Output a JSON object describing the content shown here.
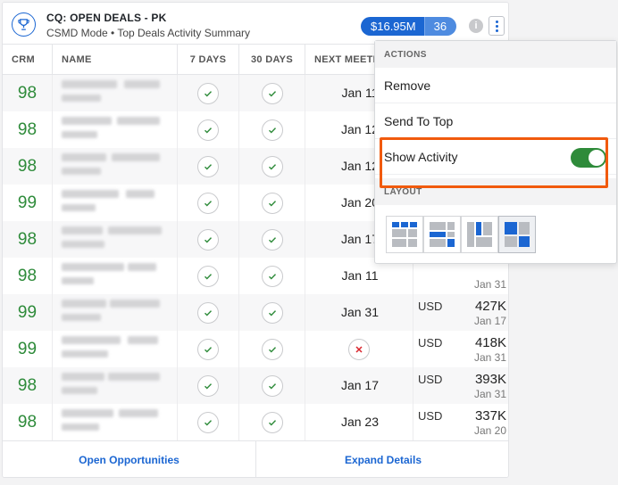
{
  "header": {
    "title": "CQ: OPEN DEALS - PK",
    "subtitle": "CSMD Mode • Top Deals Activity Summary",
    "total_amount": "$16.95M",
    "deal_count": "36",
    "info_label": "i"
  },
  "columns": {
    "crm": "CRM",
    "name": "NAME",
    "days7": "7 DAYS",
    "days30": "30 DAYS",
    "next_meeting": "NEXT MEETI"
  },
  "rows": [
    {
      "crm": "98",
      "d7": "check",
      "d30": "check",
      "next": "Jan 11",
      "currency": "",
      "amount": "",
      "date": ""
    },
    {
      "crm": "98",
      "d7": "check",
      "d30": "check",
      "next": "Jan 12",
      "currency": "",
      "amount": "",
      "date": ""
    },
    {
      "crm": "98",
      "d7": "check",
      "d30": "check",
      "next": "Jan 12",
      "currency": "",
      "amount": "",
      "date": ""
    },
    {
      "crm": "99",
      "d7": "check",
      "d30": "check",
      "next": "Jan 20",
      "currency": "",
      "amount": "",
      "date": ""
    },
    {
      "crm": "98",
      "d7": "check",
      "d30": "check",
      "next": "Jan 17",
      "currency": "",
      "amount": "",
      "date": ""
    },
    {
      "crm": "98",
      "d7": "check",
      "d30": "check",
      "next": "Jan 11",
      "currency": "",
      "amount": "",
      "date": "Jan 31"
    },
    {
      "crm": "99",
      "d7": "check",
      "d30": "check",
      "next": "Jan 31",
      "currency": "USD",
      "amount": "427K",
      "date": "Jan 17"
    },
    {
      "crm": "99",
      "d7": "check",
      "d30": "check",
      "next": "cross",
      "currency": "USD",
      "amount": "418K",
      "date": "Jan 31"
    },
    {
      "crm": "98",
      "d7": "check",
      "d30": "check",
      "next": "Jan 17",
      "currency": "USD",
      "amount": "393K",
      "date": "Jan 31"
    },
    {
      "crm": "98",
      "d7": "check",
      "d30": "check",
      "next": "Jan 23",
      "currency": "USD",
      "amount": "337K",
      "date": "Jan 20"
    }
  ],
  "footer": {
    "open_opportunities": "Open Opportunities",
    "expand_details": "Expand Details"
  },
  "menu": {
    "actions_header": "ACTIONS",
    "remove": "Remove",
    "send_to_top": "Send To Top",
    "show_activity": "Show Activity",
    "show_activity_on": true,
    "layout_header": "LAYOUT",
    "layouts": [
      "layout-small-tiles",
      "layout-wide-left",
      "layout-tall-left",
      "layout-large-tile"
    ],
    "selected_layout": "layout-large-tile"
  },
  "colors": {
    "accent": "#1b66d2",
    "crm_green": "#2e8b3a",
    "highlight": "#f15a0d",
    "toggle_on": "#2e8b3a"
  }
}
